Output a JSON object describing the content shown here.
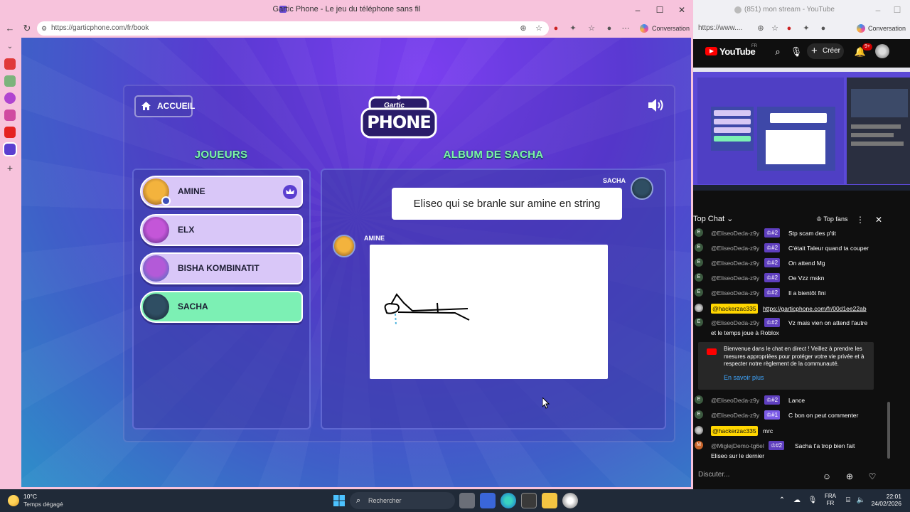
{
  "left_window": {
    "title": "Gartic Phone - Le jeu du téléphone sans fil",
    "url": "https://garticphone.com/fr/book",
    "conversation_label": "Conversation"
  },
  "gartic": {
    "home_label": "ACCUEIL",
    "logo_top": "Gartic",
    "logo_bottom": "PHONE",
    "players_title": "JOUEURS",
    "album_title": "ALBUM DE SACHA",
    "players": [
      {
        "name": "AMINE",
        "host": true,
        "active": false
      },
      {
        "name": "ELX",
        "host": false,
        "active": false
      },
      {
        "name": "BISHA KOMBINATIT",
        "host": false,
        "active": false
      },
      {
        "name": "SACHA",
        "host": false,
        "active": true
      }
    ],
    "album": {
      "first_author": "SACHA",
      "first_text": "Eliseo qui se branle sur amine en string",
      "second_author": "AMINE"
    },
    "colors": {
      "accent_green": "#7cf5a5",
      "panel": "#3c3caa",
      "active_player": "#7cf0b4",
      "player": "#d9c7f8"
    }
  },
  "right_window": {
    "title": "(851) mon stream - YouTube",
    "url": "https://www....",
    "conversation_label": "Conversation"
  },
  "youtube": {
    "logo": "YouTube",
    "region": "FR",
    "create_label": "Créer",
    "notif_count": "9+",
    "chat_mode": "Top Chat",
    "top_fans": "Top fans",
    "messages": [
      {
        "avatar": "E",
        "author": "@EliseoDeda-z9y",
        "badge": "#2",
        "text": "Stp scam des p'tit"
      },
      {
        "avatar": "E",
        "author": "@EliseoDeda-z9y",
        "badge": "#2",
        "text": "C'était Taleur quand ta couper"
      },
      {
        "avatar": "E",
        "author": "@EliseoDeda-z9y",
        "badge": "#2",
        "text": "On attend Mg"
      },
      {
        "avatar": "E",
        "author": "@EliseoDeda-z9y",
        "badge": "#2",
        "text": "Oe Vzz mskn"
      },
      {
        "avatar": "E",
        "author": "@EliseoDeda-z9y",
        "badge": "#2",
        "text": "Il a bientôt fini"
      },
      {
        "avatar": "",
        "author": "@hackerzac335",
        "badge": "",
        "text": "https://garticphone.com/fr/00d1ee22ab",
        "highlight": true,
        "link": true
      },
      {
        "avatar": "E",
        "author": "@EliseoDeda-z9y",
        "badge": "#2",
        "text": "Vz mais vien on attend l'autre",
        "text2": "et le temps joue à Roblox"
      }
    ],
    "welcome": {
      "text": "Bienvenue dans le chat en direct ! Veillez à prendre les mesures appropriées pour protéger votre vie privée et à respecter notre règlement de la communauté.",
      "link": "En savoir plus"
    },
    "messages_after": [
      {
        "avatar": "E",
        "author": "@EliseoDeda-z9y",
        "badge": "#2",
        "text": "Lance"
      },
      {
        "avatar": "E",
        "author": "@EliseoDeda-z9y",
        "badge": "#1",
        "text": "C bon on peut commenter"
      },
      {
        "avatar": "",
        "author": "@hackerzac335",
        "badge": "",
        "text": "mrc",
        "highlight": true
      },
      {
        "avatar": "M",
        "author": "@MiglejDemo-tg6el",
        "badge": "#2",
        "text": "Sacha t'a trop bien fait",
        "text2": "Eliseo sur le dernier"
      }
    ],
    "input_placeholder": "Discuter..."
  },
  "taskbar": {
    "temperature": "10°C",
    "weather": "Temps dégagé",
    "search_placeholder": "Rechercher",
    "lang_top": "FRA",
    "lang_bottom": "FR",
    "time": "22:01",
    "date": "24/02/2026"
  }
}
